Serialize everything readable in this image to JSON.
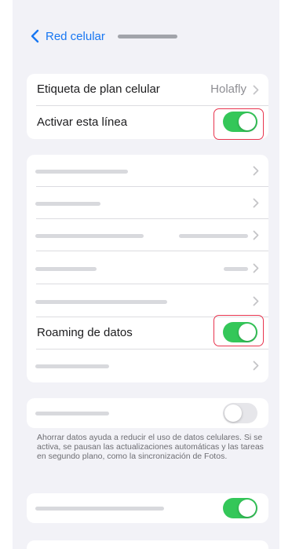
{
  "nav": {
    "back_label": "Red celular"
  },
  "plan_section": {
    "plan_label": "Etiqueta de plan celular",
    "plan_value": "Holafly",
    "line_label": "Activar esta línea",
    "line_enabled": true
  },
  "settings_section": {
    "roaming_label": "Roaming de datos",
    "roaming_enabled": true
  },
  "low_data": {
    "enabled": false,
    "footnote": "Ahorrar datos ayuda a reducir el uso de datos celulares. Si se activa, se pausan las actualizaciones automáticas y las tareas en segundo plano, como la sincronización de Fotos."
  },
  "last_toggle": {
    "enabled": true
  },
  "colors": {
    "accent": "#1877f2",
    "toggle_on": "#34c759",
    "highlight": "#e8344e"
  }
}
